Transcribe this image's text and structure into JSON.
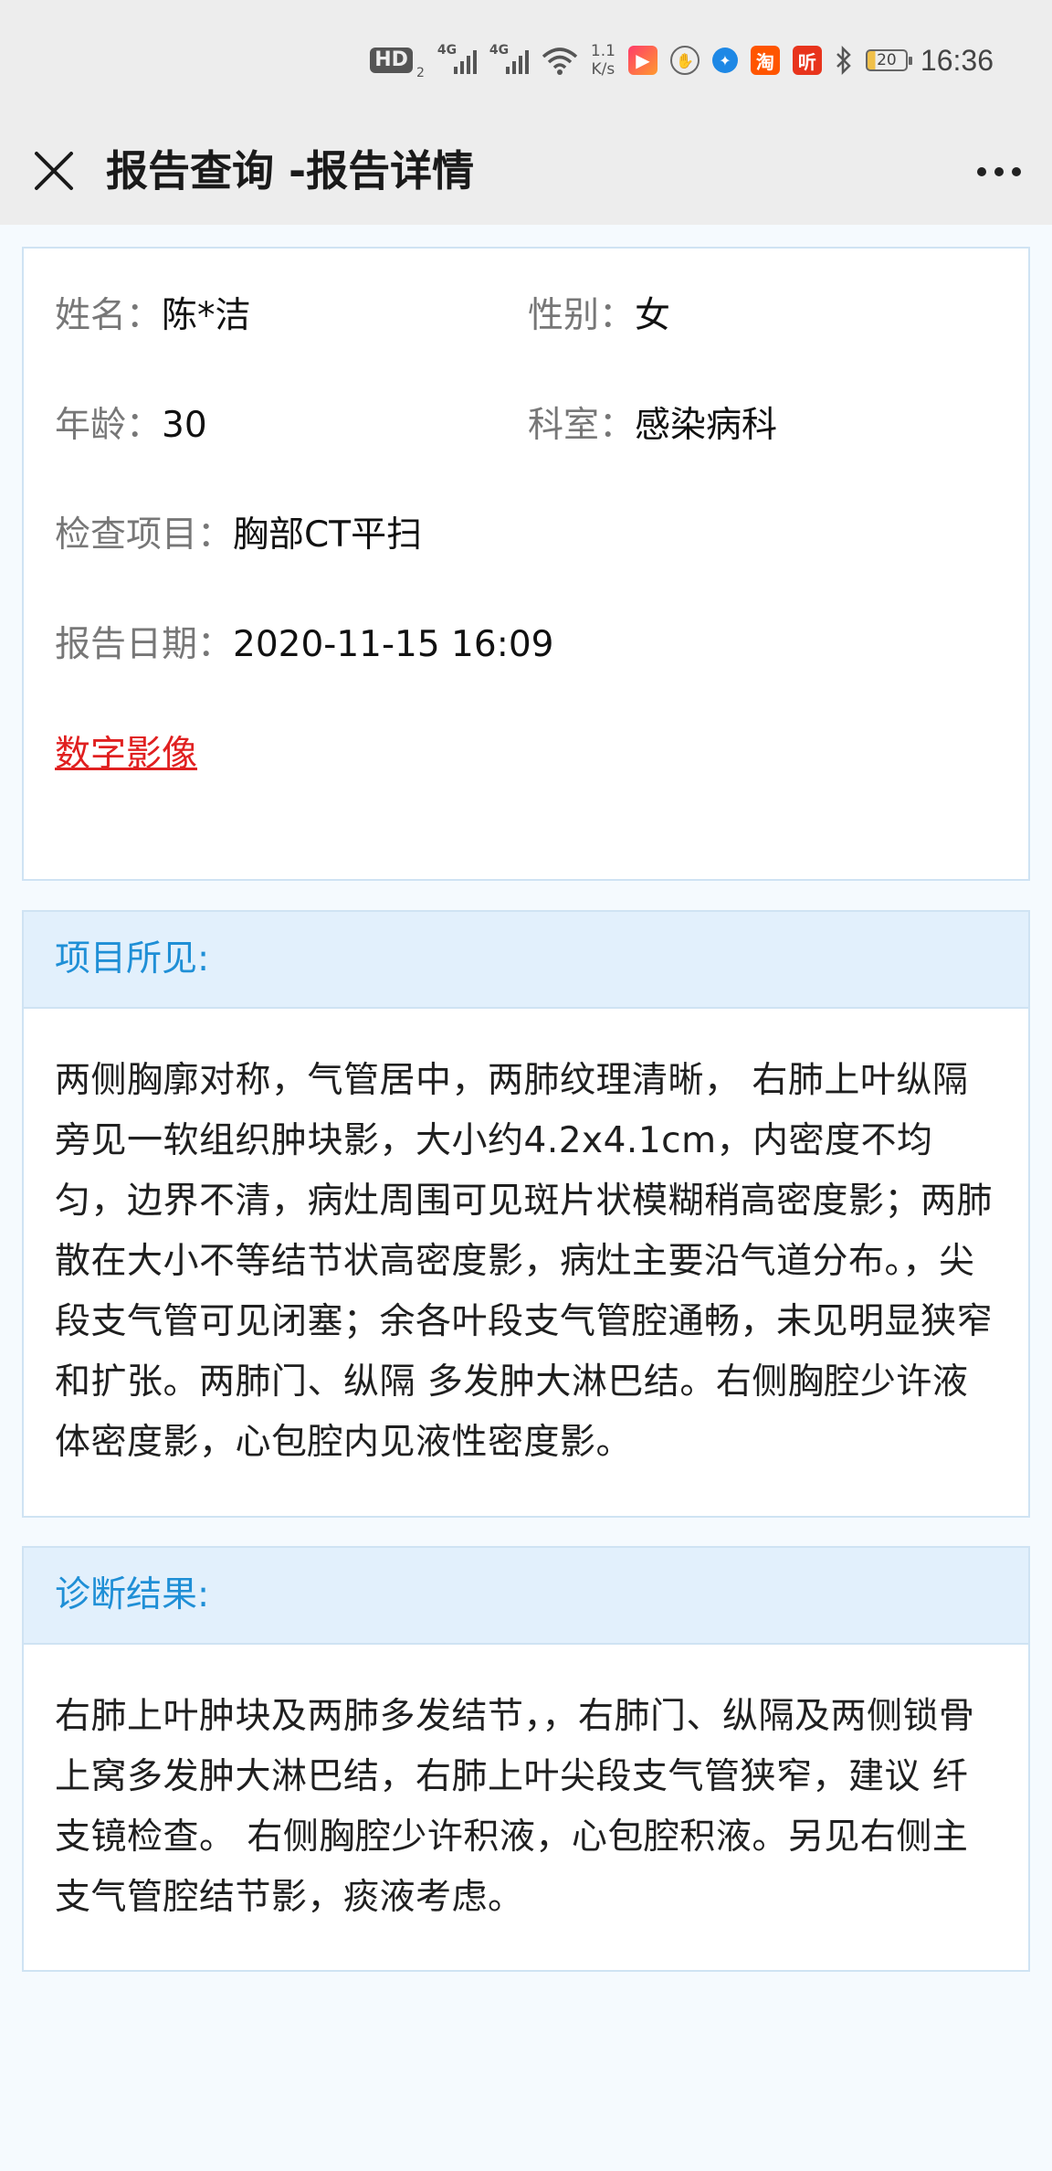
{
  "status_bar": {
    "hd_label": "HD",
    "hd_sub": "2",
    "net_gen_1": "4G",
    "net_gen_2": "4G",
    "speed_value": "1.1",
    "speed_unit": "K/s",
    "app_icons": [
      "kuaishou-icon",
      "hand-icon",
      "blue-app-icon",
      "taobao-icon",
      "ting-icon"
    ],
    "app_taobao": "淘",
    "app_ting": "听",
    "battery": "20",
    "time": "16:36"
  },
  "header": {
    "title": "报告查询 -报告详情"
  },
  "patient": {
    "name_label": "姓名：",
    "name_value": "陈*洁",
    "gender_label": "性别：",
    "gender_value": "女",
    "age_label": "年龄：",
    "age_value": "30",
    "dept_label": "科室：",
    "dept_value": "感染病科",
    "exam_label": "检查项目：",
    "exam_value": "胸部CT平扫",
    "date_label": "报告日期：",
    "date_value": "2020-11-15 16:09",
    "image_link": "数字影像"
  },
  "findings": {
    "title": "项目所见:",
    "text": "两侧胸廓对称，气管居中，两肺纹理清晰， 右肺上叶纵隔旁见一软组织肿块影，大小约4.2x4.1cm，内密度不均匀，边界不清，病灶周围可见斑片状模糊稍高密度影；两肺散在大小不等结节状高密度影，病灶主要沿气道分布。，尖段支气管可见闭塞；余各叶段支气管腔通畅，未见明显狭窄和扩张。两肺门、纵隔 多发肿大淋巴结。右侧胸腔少许液体密度影，心包腔内见液性密度影。"
  },
  "diagnosis": {
    "title": "诊断结果:",
    "text": "右肺上叶肿块及两肺多发结节，，右肺门、纵隔及两侧锁骨上窝多发肿大淋巴结，右肺上叶尖段支气管狭窄，建议 纤支镜检查。 右侧胸腔少许积液，心包腔积液。另见右侧主支气管腔结节影，痰液考虑。"
  },
  "colors": {
    "accent": "#1f8fd6",
    "link": "#e02020",
    "header_bg": "#ededed",
    "section_head_bg": "#e2f0fc"
  }
}
